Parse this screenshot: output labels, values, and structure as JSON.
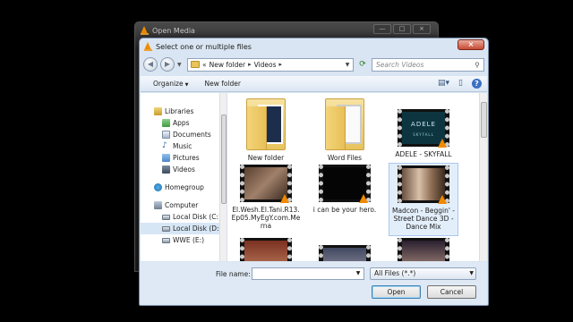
{
  "background_window": {
    "title": "Open Media",
    "controls": [
      "—",
      "□",
      "×"
    ]
  },
  "dialog": {
    "title": "Select one or multiple files",
    "close_label": "×"
  },
  "address_bar": {
    "segments": [
      "«",
      "New folder",
      "▸",
      "Videos",
      "▸"
    ],
    "search_placeholder": "Search Videos"
  },
  "toolbar": {
    "organize": "Organize",
    "new_folder": "New folder"
  },
  "nav": {
    "libraries": "Libraries",
    "apps": "Apps",
    "documents": "Documents",
    "music": "Music",
    "pictures": "Pictures",
    "videos": "Videos",
    "homegroup": "Homegroup",
    "computer": "Computer",
    "local_c": "Local Disk (C:)",
    "local_d": "Local Disk  (D:)",
    "wwe": "WWE (E:)"
  },
  "files": [
    {
      "name": "New folder",
      "type": "folder"
    },
    {
      "name": "Word Files",
      "type": "folder"
    },
    {
      "name": "ADELE - SKYFALL",
      "type": "video",
      "thumb_text": "ADELE",
      "thumb_sub": "SKYFALL"
    },
    {
      "name": "El.Wesh.El.Tani.R13.Ep05.MyEgY.com.Merna",
      "type": "video"
    },
    {
      "name": "i can be your hero.",
      "type": "video"
    },
    {
      "name": "Madcon - Beggin' - Street Dance 3D - Dance Mix",
      "type": "video"
    }
  ],
  "bottom": {
    "file_name_label": "File name:",
    "file_name_value": "",
    "filter": "All Files (*.*)",
    "open": "Open",
    "cancel": "Cancel"
  }
}
